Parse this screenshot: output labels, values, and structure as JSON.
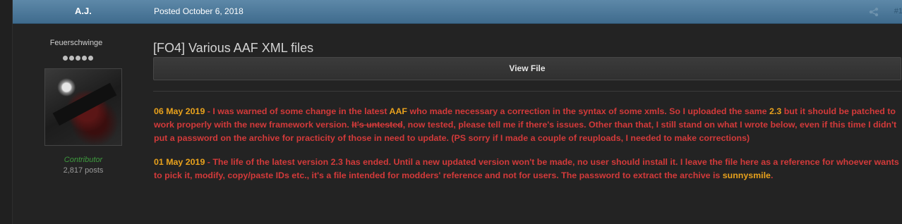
{
  "header": {
    "author_name": "A.J.",
    "posted": "Posted October 6, 2018",
    "post_number": "#1",
    "share_icon": "share-icon"
  },
  "author": {
    "title": "Feuerschwinge",
    "rank_pips": 5,
    "group": "Contributor",
    "post_count": "2,817 posts"
  },
  "post": {
    "title": "[FO4] Various AAF XML files",
    "view_file_label": "View File",
    "colors": {
      "body_text": "#d33a3a",
      "highlight": "#e8a11c",
      "header": "#4f7a9b",
      "group": "#3e9a3e"
    },
    "update1": {
      "date": "06 May 2019",
      "t1": " - I was warned of some change in the latest ",
      "aaf": "AAF",
      "t2": " who made necessary a correction in the syntax of some xmls. So I uploaded the same ",
      "version": "2.3",
      "t3": " but it should be patched to work properly with the new framework version. ",
      "strike": "It's untested",
      "t4": ", now tested, please tell me if there's issues. Other than that, I still stand on what I wrote below, even if this time I didn't put a password on the archive for practicity of those in need to update. (PS sorry if I made a couple of reuploads, I needed to make corrections)"
    },
    "update2": {
      "date": "01 May 2019",
      "t1": " - The life of the latest version 2.3 has ended. Until a new updated version won't be made, no user should install it. I leave the file here as a reference for whoever wants to pick it, modify, copy/paste IDs etc., it's a file intended for modders' reference and not for users. The password to extract the archive is ",
      "password": "sunnysmile",
      "t2": "."
    }
  }
}
